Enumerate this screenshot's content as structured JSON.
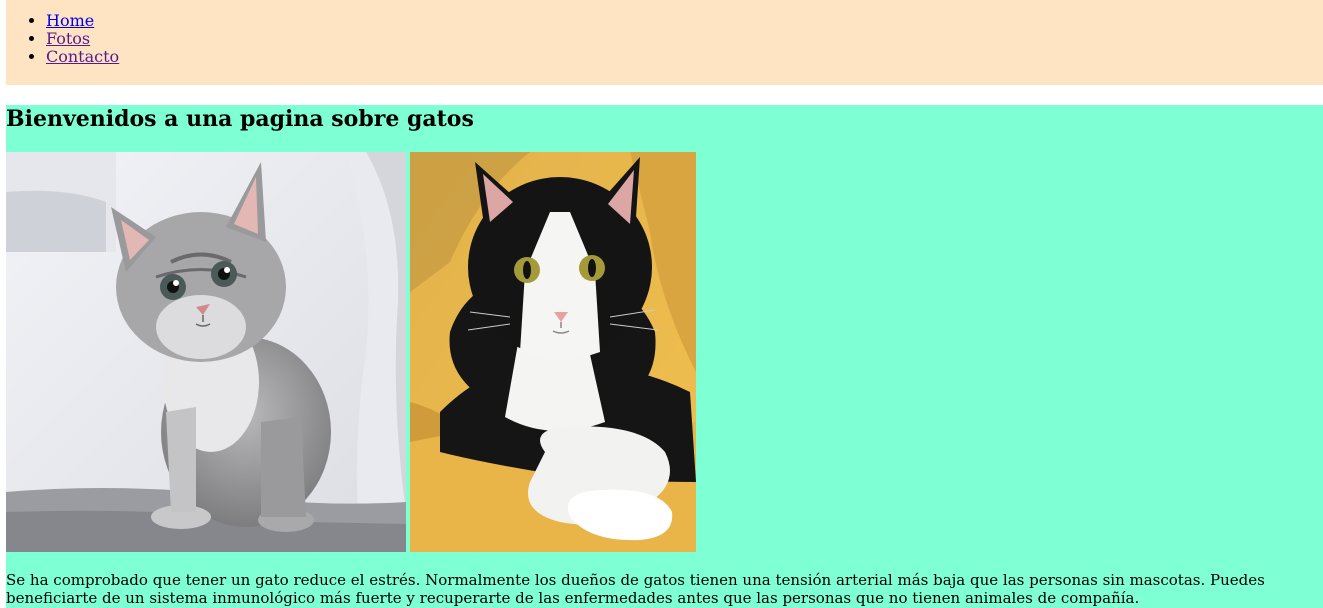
{
  "nav": {
    "items": [
      {
        "label": "Home"
      },
      {
        "label": "Fotos"
      },
      {
        "label": "Contacto"
      }
    ]
  },
  "main": {
    "heading": "Bienvenidos a una pagina sobre gatos",
    "images": [
      {
        "alt": "Gatito gris atigrado sentado en un sofá"
      },
      {
        "alt": "Gato blanco y negro recostado sobre una manta amarilla"
      }
    ],
    "paragraph": "Se ha comprobado que tener un gato reduce el estrés. Normalmente los dueños de gatos tienen una tensión arterial más baja que las personas sin mascotas. Puedes beneficiarte de un sistema inmunológico más fuerte y recuperarte de las enfermedades antes que las personas que no tienen animales de compañía."
  },
  "colors": {
    "nav_background": "#ffe4c4",
    "main_background": "#7fffd4",
    "link": "#0000ee",
    "link_visited": "#551a8b"
  }
}
